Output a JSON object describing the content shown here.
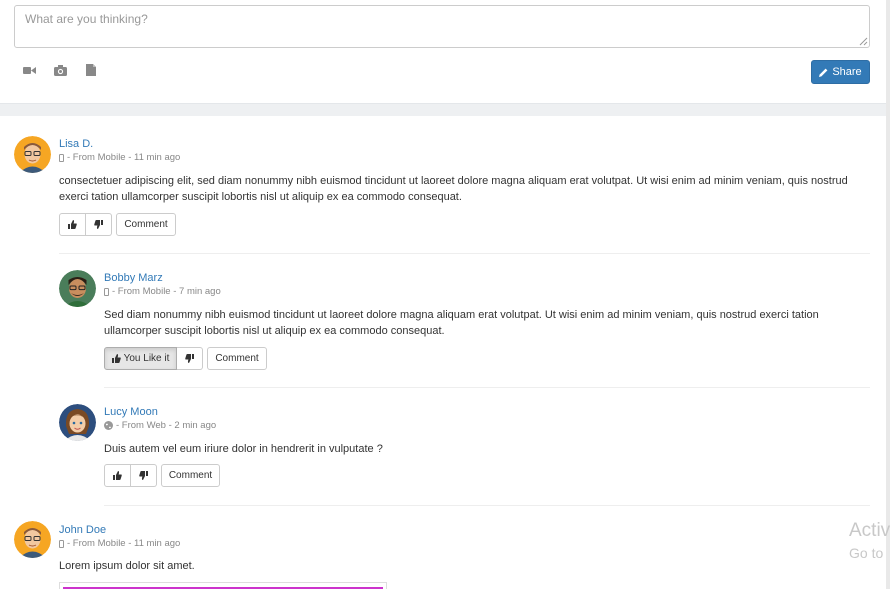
{
  "composer": {
    "placeholder": "What are you thinking?",
    "tools": [
      "video-icon",
      "camera-icon",
      "file-icon"
    ],
    "share_label": "Share"
  },
  "colors": {
    "link": "#337ab7",
    "primary": "#337ab7",
    "muted": "#888888",
    "image_strip": "#cc33cc"
  },
  "posts": [
    {
      "author": "Lisa D.",
      "meta": "- From Mobile - 11 min ago",
      "source_icon": "mobile-icon",
      "text": "consectetuer adipiscing elit, sed diam nonummy nibh euismod tincidunt ut laoreet dolore magna aliquam erat volutpat. Ut wisi enim ad minim veniam, quis nostrud exerci tation ullamcorper suscipit lobortis nisl ut aliquip ex ea commodo consequat.",
      "comment_label": "Comment"
    },
    {
      "author": "Bobby Marz",
      "meta": "- From Mobile - 7 min ago",
      "source_icon": "mobile-icon",
      "text": "Sed diam nonummy nibh euismod tincidunt ut laoreet dolore magna aliquam erat volutpat. Ut wisi enim ad minim veniam, quis nostrud exerci tation ullamcorper suscipit lobortis nisl ut aliquip ex ea commodo consequat.",
      "like_label": "You Like it",
      "comment_label": "Comment"
    },
    {
      "author": "Lucy Moon",
      "meta": "- From Web - 2 min ago",
      "source_icon": "globe-icon",
      "text": "Duis autem vel eum iriure dolor in hendrerit in vulputate ?",
      "comment_label": "Comment"
    },
    {
      "author": "John Doe",
      "meta": "- From Mobile - 11 min ago",
      "source_icon": "mobile-icon",
      "text": "Lorem ipsum dolor sit amet."
    }
  ],
  "watermark": {
    "line1": "Activ",
    "line2": "Go to"
  }
}
